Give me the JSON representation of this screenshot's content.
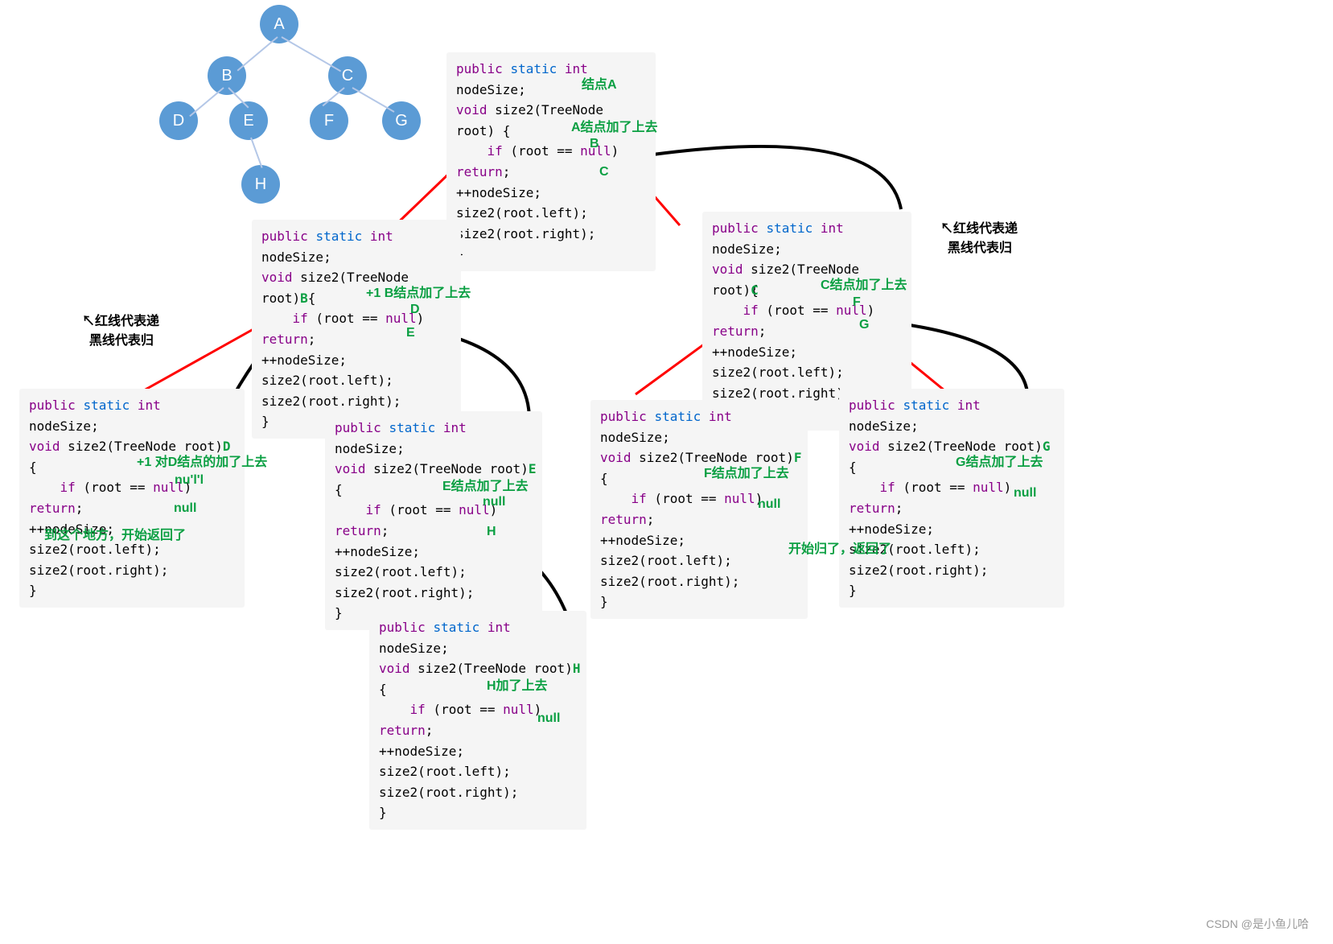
{
  "tree": {
    "nodes": {
      "A": "A",
      "B": "B",
      "C": "C",
      "D": "D",
      "E": "E",
      "F": "F",
      "G": "G",
      "H": "H"
    }
  },
  "codeA": {
    "line1_1": "public",
    "line1_2": "static",
    "line1_3": "int",
    "line1_4": " nodeSize;",
    "line2_1": "void",
    "line2_2": " size2(TreeNode root) {",
    "line3_1": "if",
    "line3_2": " (root == ",
    "line3_3": "null",
    "line3_4": ") ",
    "line3_5": "return",
    "line3_6": ";",
    "line4": "    ++nodeSize;",
    "line5": "    size2(root.left);",
    "line6": "    size2(root.right);",
    "line7": "}"
  },
  "codeB": {
    "param": "B"
  },
  "codeC": {
    "param": "C"
  },
  "codeD": {
    "param": "D"
  },
  "codeE": {
    "param": "E"
  },
  "codeF": {
    "param": "F"
  },
  "codeG": {
    "param": "G"
  },
  "codeH": {
    "param": "H"
  },
  "annotations": {
    "a_node": "结点A",
    "a_added": "A结点加了上去",
    "a_left_B": "B",
    "a_right_C": "C",
    "b_added": "+1 B结点加了上去",
    "b_left_D": "D",
    "b_right_E": "E",
    "c_added": "C结点加了上去",
    "c_left_F": "F",
    "c_right_G": "G",
    "d_added": "+1 对D结点的加了上去",
    "d_left_null": "nu'l'l",
    "d_right_null": "null",
    "d_return": "到这个地方，开始返回了",
    "e_added": "E结点加了上去",
    "e_left_null": "null",
    "e_right_H": "H",
    "f_added": "F结点加了上去",
    "f_right_null": "null",
    "g_added": "G结点加了上去",
    "g_right_null": "null",
    "g_return": "开始归了，返回了",
    "h_added": "H加了上去",
    "h_right_null": "null"
  },
  "legend": {
    "red": "红线代表递",
    "black": "黑线代表归"
  },
  "watermark": "CSDN @是小鱼儿哈"
}
